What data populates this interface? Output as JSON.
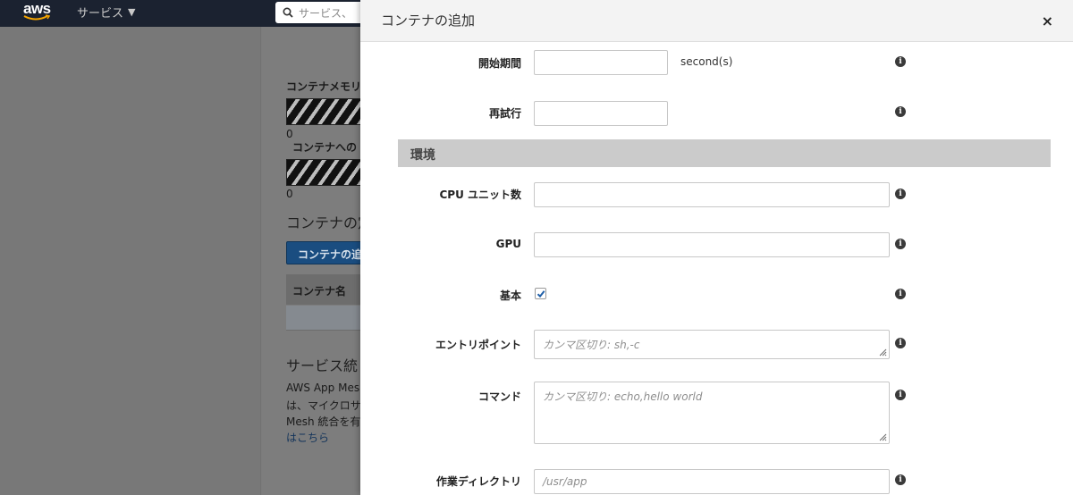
{
  "topnav": {
    "logo_text": "aws",
    "services_label": "サービス",
    "search_placeholder": "サービス、"
  },
  "background": {
    "memory_label": "コンテナメモリ",
    "memory_value": "0",
    "cpu_label": "コンテナへの",
    "cpu_value": "0",
    "containers_heading": "コンテナの定",
    "add_container_button": "コンテナの追",
    "table_header_name": "コンテナ名",
    "service_integration_heading": "サービス統",
    "app_mesh_line1": "AWS App Mesh",
    "app_mesh_line2": "は、マイクロサ",
    "app_mesh_line3": "Mesh 統合を有",
    "link_text": "はこちら"
  },
  "modal": {
    "title": "コンテナの追加",
    "close_icon": "×",
    "fields": {
      "start_period": {
        "label": "開始期間",
        "value": "",
        "unit": "second(s)"
      },
      "retries": {
        "label": "再試行",
        "value": ""
      },
      "cpu_units": {
        "label": "CPU ユニット数",
        "value": ""
      },
      "gpu": {
        "label": "GPU",
        "value": ""
      },
      "essential": {
        "label": "基本",
        "checked": true
      },
      "entry_point": {
        "label": "エントリポイント",
        "placeholder": "カンマ区切り: sh,-c"
      },
      "command": {
        "label": "コマンド",
        "placeholder": "カンマ区切り: echo,hello world"
      },
      "working_directory": {
        "label": "作業ディレクトリ",
        "placeholder": "/usr/app"
      }
    },
    "environment_section": "環境",
    "info_glyph": "i"
  },
  "colors": {
    "nav_bg": "#1b2230",
    "overlay_bg": "#7b7b7b",
    "section_bg": "#cbcbcb",
    "checkbox_blue": "#1f5fa8"
  }
}
